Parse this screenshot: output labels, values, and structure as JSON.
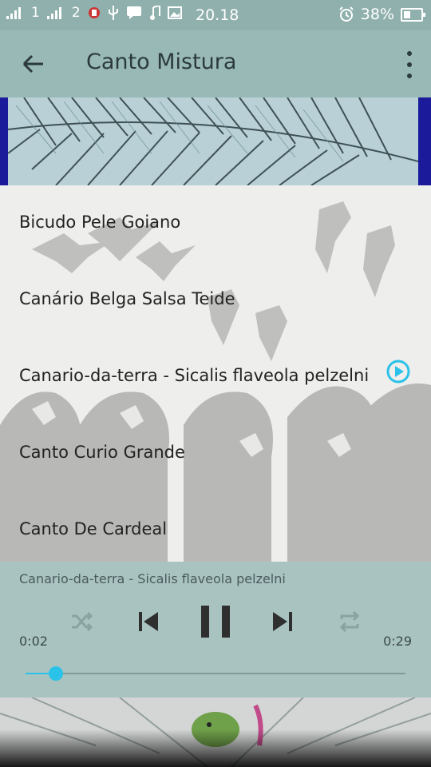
{
  "status_bar": {
    "carrier1": "1",
    "carrier2": "2",
    "time": "20.18",
    "battery": "38%"
  },
  "toolbar": {
    "title": "Canto Mistura"
  },
  "songs": [
    {
      "title": "Bicudo Pele Goiano"
    },
    {
      "title": "Canário Belga Salsa Teide"
    },
    {
      "title": "Canario-da-terra - Sicalis flaveola pelzelni"
    },
    {
      "title": "Canto Curio Grande"
    },
    {
      "title": "Canto De Cardeal"
    }
  ],
  "player": {
    "now_playing": "Canario-da-terra - Sicalis flaveola pelzelni",
    "elapsed": "0:02",
    "duration": "0:29",
    "progress": 0.08
  }
}
